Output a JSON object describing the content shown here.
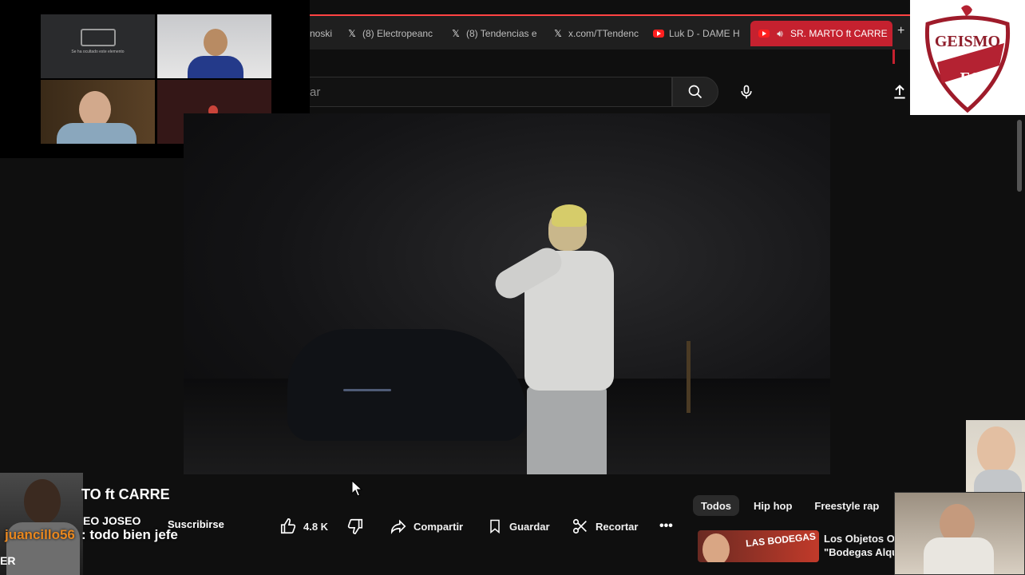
{
  "browser": {
    "tabs": [
      {
        "label": "noski",
        "icon": "none"
      },
      {
        "label": "(8) Electropeanc",
        "icon": "x-logo-icon"
      },
      {
        "label": "(8) Tendencias e",
        "icon": "x-logo-icon"
      },
      {
        "label": "x.com/TTendenc",
        "icon": "x-logo-icon"
      },
      {
        "label": "Luk D - DAME H",
        "icon": "youtube-icon"
      },
      {
        "label": "SR. MARTO ft CARRE",
        "icon": "youtube-icon",
        "active": true
      }
    ],
    "new_tab": "+"
  },
  "youtube": {
    "search_placeholder": "ar"
  },
  "video": {
    "title": "TO ft CARRE",
    "channel": "EO JOSEO",
    "subscribe_label": "Suscribirse",
    "like_count": "4.8 K",
    "share_label": "Compartir",
    "save_label": "Guardar",
    "clip_label": "Recortar",
    "more_label": "•••"
  },
  "chips": [
    "Todos",
    "Hip hop",
    "Freestyle rap"
  ],
  "recommendation": {
    "thumb_text": "LAS BODEGAS",
    "title_line1": "Los Objetos OC",
    "title_line2": "\"Bodegas Alqu"
  },
  "chat": {
    "user": "juancillo56",
    "message": ": todo bien jefe"
  },
  "overlay": {
    "crest_text_top": "GEISMO",
    "crest_text_bottom": "FC",
    "cam_message": "Se ha ocultado este elemento",
    "edge_text": "ER"
  },
  "colors": {
    "accent": "#c5212f",
    "chat_user": "#e8871f",
    "youtube_red": "#ff1f1f"
  }
}
